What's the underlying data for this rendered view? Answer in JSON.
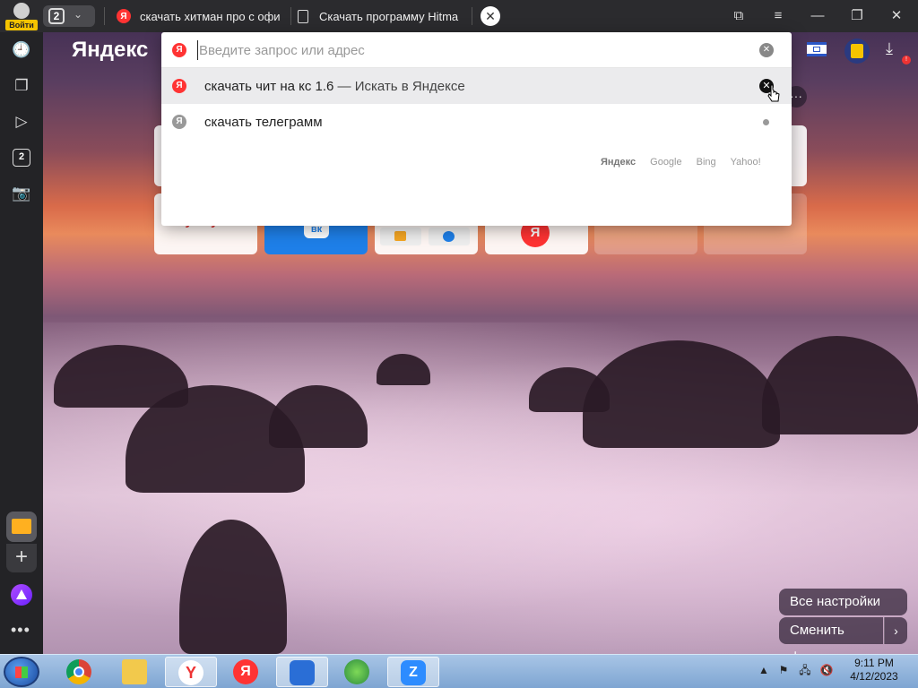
{
  "titlebar": {
    "login_label": "Войти",
    "tab_count": "2",
    "tabs": [
      {
        "title": "скачать хитман про с офи"
      },
      {
        "title": "Скачать программу Hitma"
      }
    ],
    "close_tab_glyph": "✕"
  },
  "header": {
    "logo": "Яндекс"
  },
  "omnibox": {
    "placeholder": "Введите запрос или адрес",
    "value": "",
    "suggestions": [
      {
        "query": "скачать чит на кс 1.6",
        "suffix": " — Искать в Яндексе",
        "icon": "yandex-red"
      },
      {
        "query": "скачать телеграмм",
        "suffix": "",
        "icon": "yandex-gray"
      }
    ],
    "engines": [
      "Яндекс",
      "Google",
      "Bing",
      "Yahoo!"
    ],
    "selected_engine": "Яндекс"
  },
  "sidebar": {
    "tab_count": "2",
    "more_glyph": "•••"
  },
  "tiles": [
    {
      "label": "госуслуги"
    },
    {
      "label": "вк"
    },
    {
      "label": ""
    },
    {
      "label": "Я"
    }
  ],
  "actions": {
    "all_settings": "Все настройки",
    "change_bg": "Сменить фон"
  },
  "taskbar": {
    "time": "9:11 PM",
    "date": "4/12/2023"
  },
  "colors": {
    "yandex_red": "#ff3333",
    "taskbar": "#8fb3dc",
    "sidebar": "#232326"
  }
}
